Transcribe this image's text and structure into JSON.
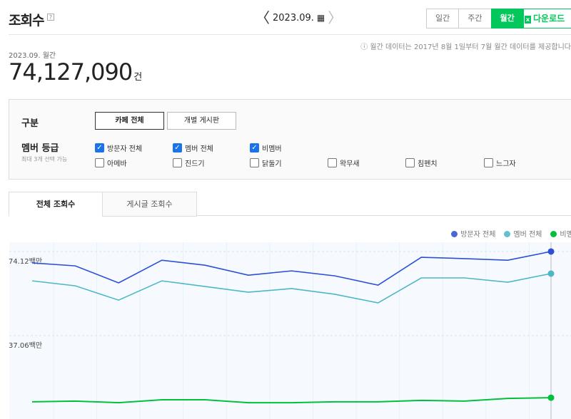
{
  "header": {
    "title": "조회수",
    "help": "?",
    "date": "2023.09.",
    "prev": "〈",
    "next": "〉",
    "calendar_icon": "calendar-icon"
  },
  "period_tabs": [
    {
      "label": "일간",
      "active": false
    },
    {
      "label": "주간",
      "active": false
    },
    {
      "label": "월간",
      "active": true
    }
  ],
  "download": {
    "icon": "x",
    "label": "다운로드"
  },
  "notice": "ⓘ 월간 데이터는 2017년 8월 1일부터 7월 월간 데이터를 제공합니다",
  "summary": {
    "period": "2023.09. 월간",
    "total": "74,127,090",
    "unit": "건"
  },
  "filter": {
    "type_label": "구분",
    "type_buttons": [
      {
        "label": "카페 전체",
        "active": true
      },
      {
        "label": "개별 게시판",
        "active": false
      }
    ],
    "grade_label": "멤버 등급",
    "grade_hint": "최대 3개 선택 가능",
    "grades": [
      {
        "label": "방문자 전체",
        "checked": true
      },
      {
        "label": "멤버 전체",
        "checked": true
      },
      {
        "label": "비멤버",
        "checked": true
      },
      {
        "label": "아메바",
        "checked": false
      },
      {
        "label": "진드기",
        "checked": false
      },
      {
        "label": "닭둘기",
        "checked": false
      },
      {
        "label": "왁무새",
        "checked": false
      },
      {
        "label": "침펜치",
        "checked": false
      },
      {
        "label": "느그자",
        "checked": false
      }
    ]
  },
  "tabs": [
    {
      "label": "전체 조회수",
      "active": true
    },
    {
      "label": "게시글 조회수",
      "active": false
    }
  ],
  "colors": {
    "accent": "#03c75a",
    "visitors": "#2c4fd8",
    "members": "#4db8c4",
    "nonmembers": "#03c03c"
  },
  "chart_data": {
    "type": "line",
    "y_ticks": [
      {
        "value": 74.12,
        "label": "74.12백만"
      },
      {
        "value": 37.06,
        "label": "37.06백만"
      }
    ],
    "ylim": [
      0,
      74.12
    ],
    "y_unit": "백만",
    "legend": [
      "방문자 전체",
      "멤버 전체",
      "비멤버"
    ],
    "legend_position": "top-right",
    "series": [
      {
        "name": "방문자 전체",
        "color": "#2c4fd8",
        "values": [
          69.1,
          67.8,
          60.3,
          70.3,
          68.1,
          63.7,
          65.6,
          63.4,
          59.3,
          71.6,
          71.0,
          70.3,
          74.13
        ]
      },
      {
        "name": "멤버 전체",
        "color": "#4db8c4",
        "values": [
          61.2,
          59.0,
          52.7,
          61.2,
          58.7,
          56.2,
          57.8,
          55.3,
          51.5,
          62.5,
          62.5,
          60.6,
          64.4
        ]
      },
      {
        "name": "비멤버",
        "color": "#03c03c",
        "values": [
          7.9,
          8.2,
          7.5,
          8.8,
          8.8,
          7.5,
          7.5,
          7.9,
          7.9,
          8.5,
          8.2,
          9.4,
          9.7
        ]
      }
    ]
  }
}
